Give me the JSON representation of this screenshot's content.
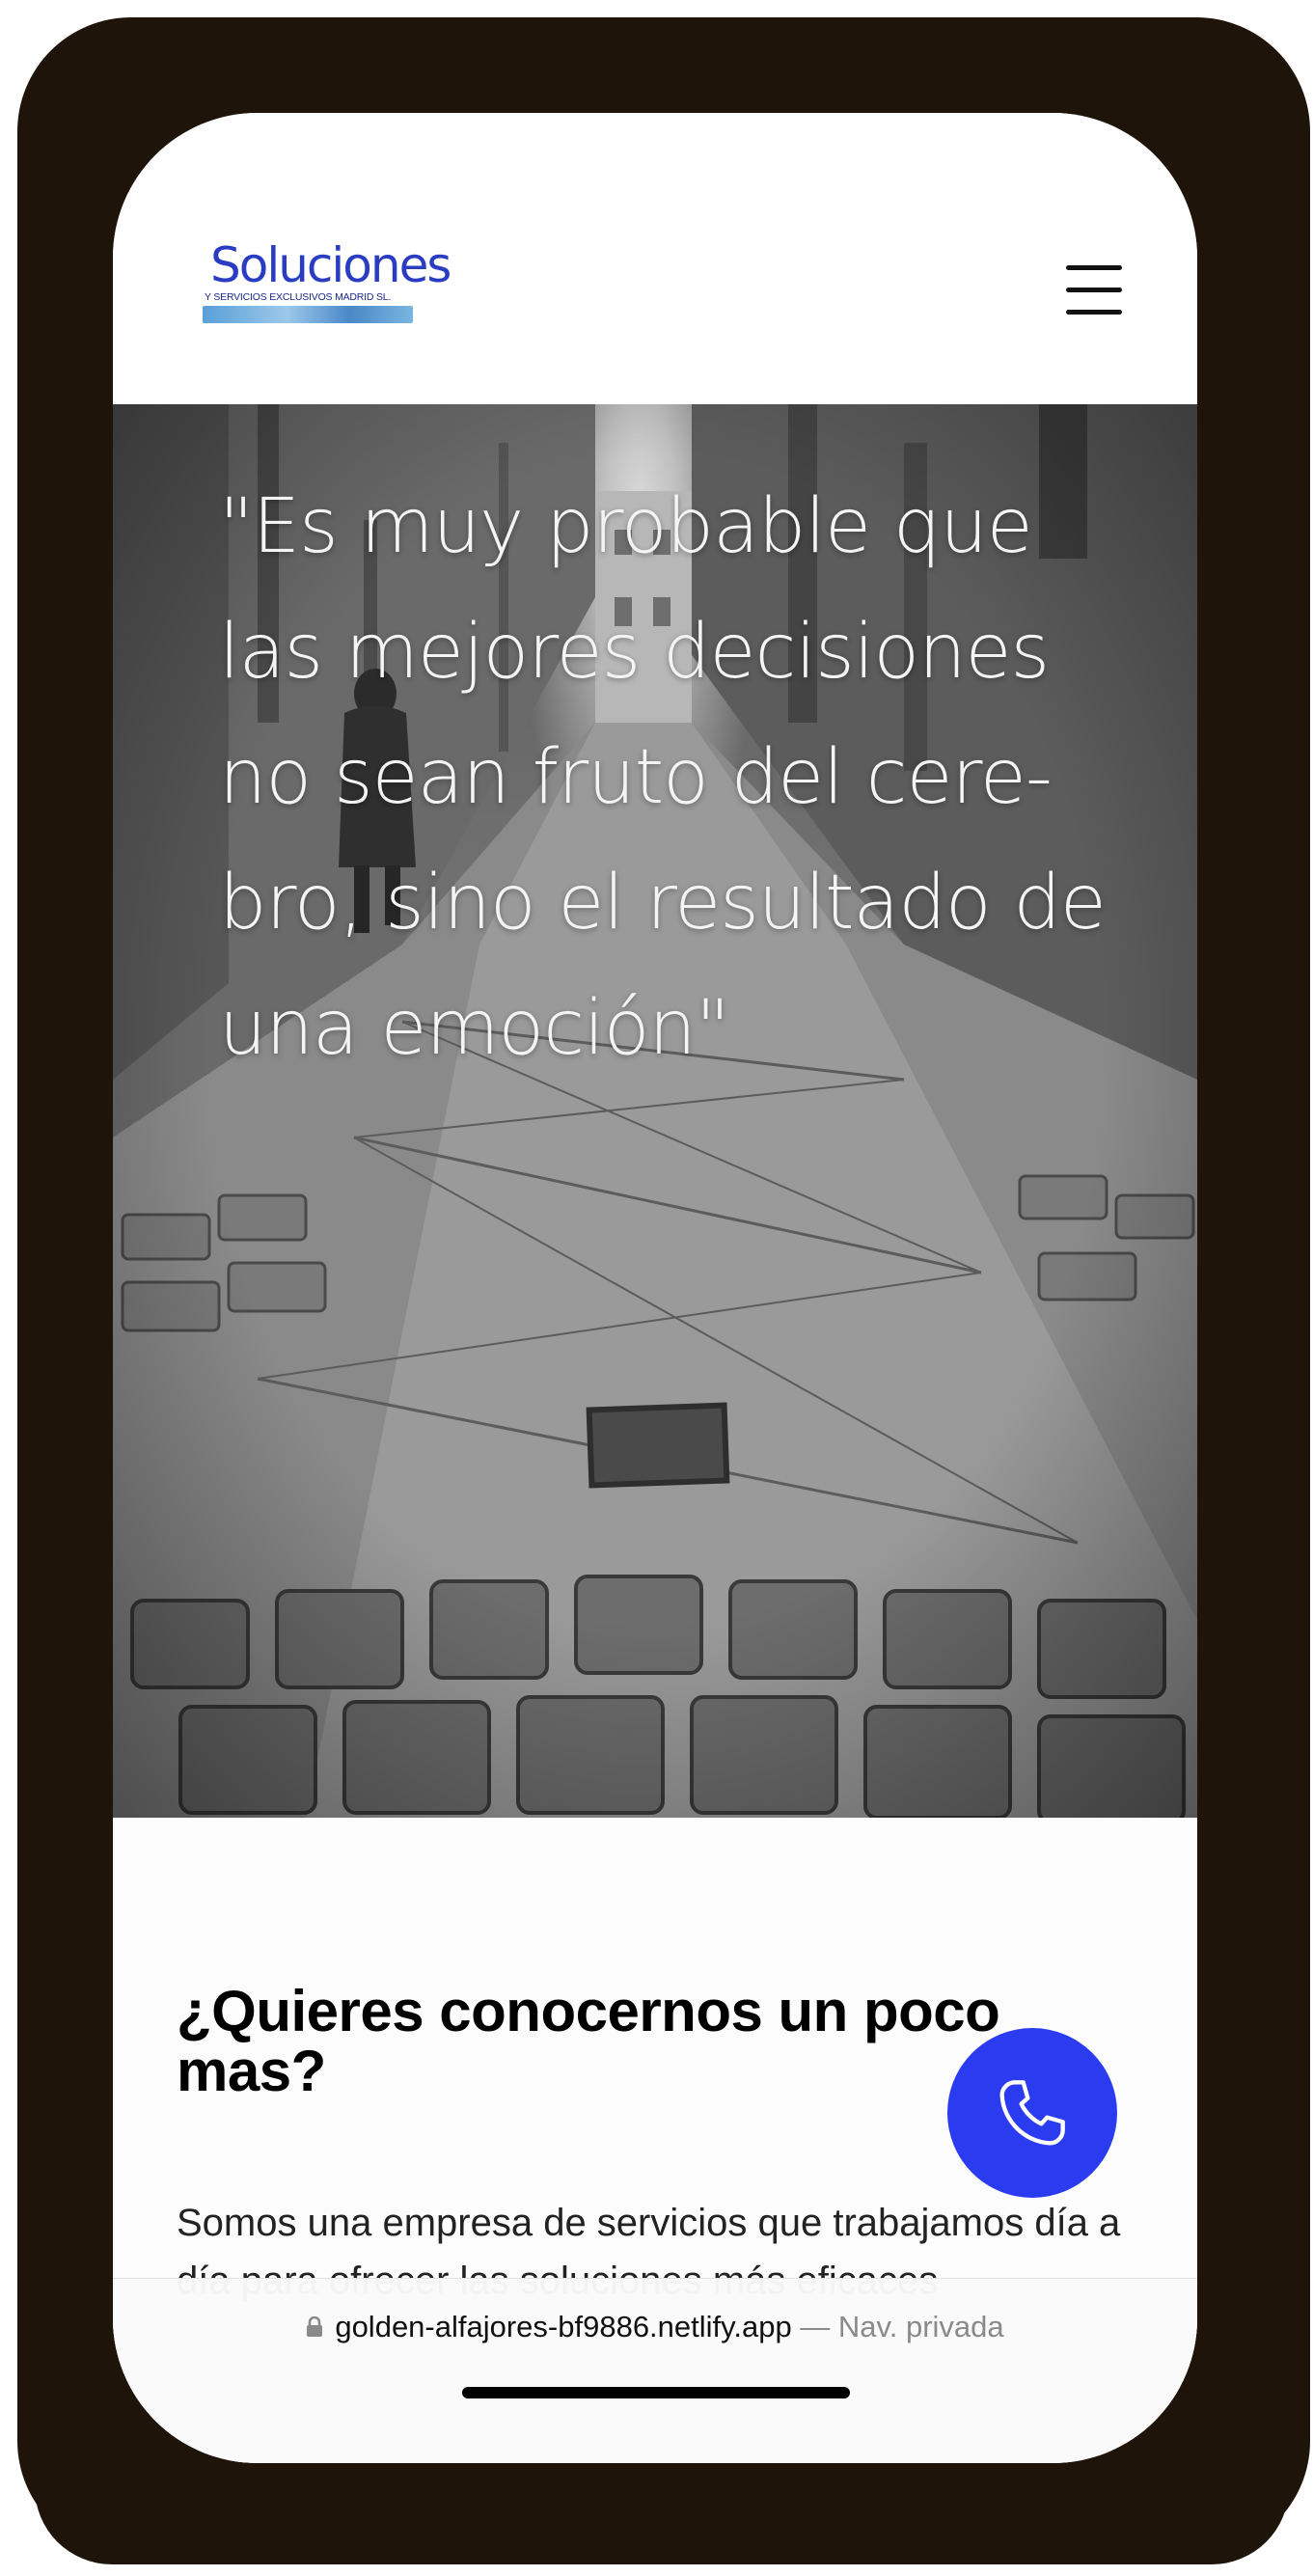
{
  "header": {
    "logo": {
      "word": "Soluciones",
      "sub": "Y SERVICIOS EXCLUSIVOS MADRID SL."
    },
    "menu_icon": "hamburger-menu-icon"
  },
  "hero": {
    "quote": "\"Es muy probable que las mejores decisiones no sean fruto del cere- bro, sino el resultado de una emoción\""
  },
  "about": {
    "title": "¿Quieres conocernos un poco mas?",
    "text": "Somos una empresa de servicios que trabajamos día a día para ofrecer las soluciones más eficaces"
  },
  "call_button": {
    "icon": "phone-icon",
    "color": "#2b3cf0"
  },
  "browser": {
    "lock_icon": "lock-icon",
    "url": "golden-alfajores-bf9886.netlify.app",
    "separator": " — ",
    "mode": "Nav. privada"
  }
}
